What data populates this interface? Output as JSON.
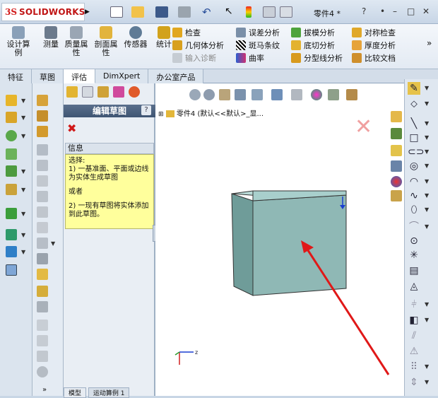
{
  "app": {
    "brand": "SOLIDWORKS",
    "brand_prefix": "3S",
    "document_title": "零件4 *"
  },
  "ribbon": {
    "design_study": "设计算例",
    "measure": "测量",
    "mass_properties": "质量属性",
    "section_properties": "剖面属性",
    "sensor": "传感器",
    "statistics": "统计",
    "check": "检查",
    "geometry_analysis": "几何体分析",
    "import_diagnostics": "输入诊断",
    "deviation_analysis": "误差分析",
    "zebra_stripes": "斑马条纹",
    "curvature": "曲率",
    "draft_analysis": "拔模分析",
    "undercut_analysis": "底切分析",
    "parting_line_analysis": "分型线分析",
    "symmetry_check": "对称检查",
    "thickness_analysis": "厚度分析",
    "compare_documents": "比较文档"
  },
  "tabs": [
    {
      "label": "特征",
      "active": false
    },
    {
      "label": "草图",
      "active": false
    },
    {
      "label": "评估",
      "active": true
    },
    {
      "label": "DimXpert",
      "active": false
    },
    {
      "label": "办公室产品",
      "active": false
    }
  ],
  "property_manager": {
    "title": "编辑草图",
    "help": "?",
    "info_title": "信息",
    "info_lines": [
      "选择:",
      "1) 一基准面、平面或边线",
      "为实体生成草图",
      "或者",
      "2) 一现有草图将实体添加",
      "到此草图。"
    ]
  },
  "graphics": {
    "tree_item": "零件4  (默认<<默认>_显..."
  },
  "bottom_tabs": [
    "模型",
    "运动算例 1"
  ],
  "colors": {
    "accent_red": "#d01818",
    "cube_face": "#8fb8b5",
    "info_bg": "#ffff9c",
    "arrow": "#e01818"
  }
}
